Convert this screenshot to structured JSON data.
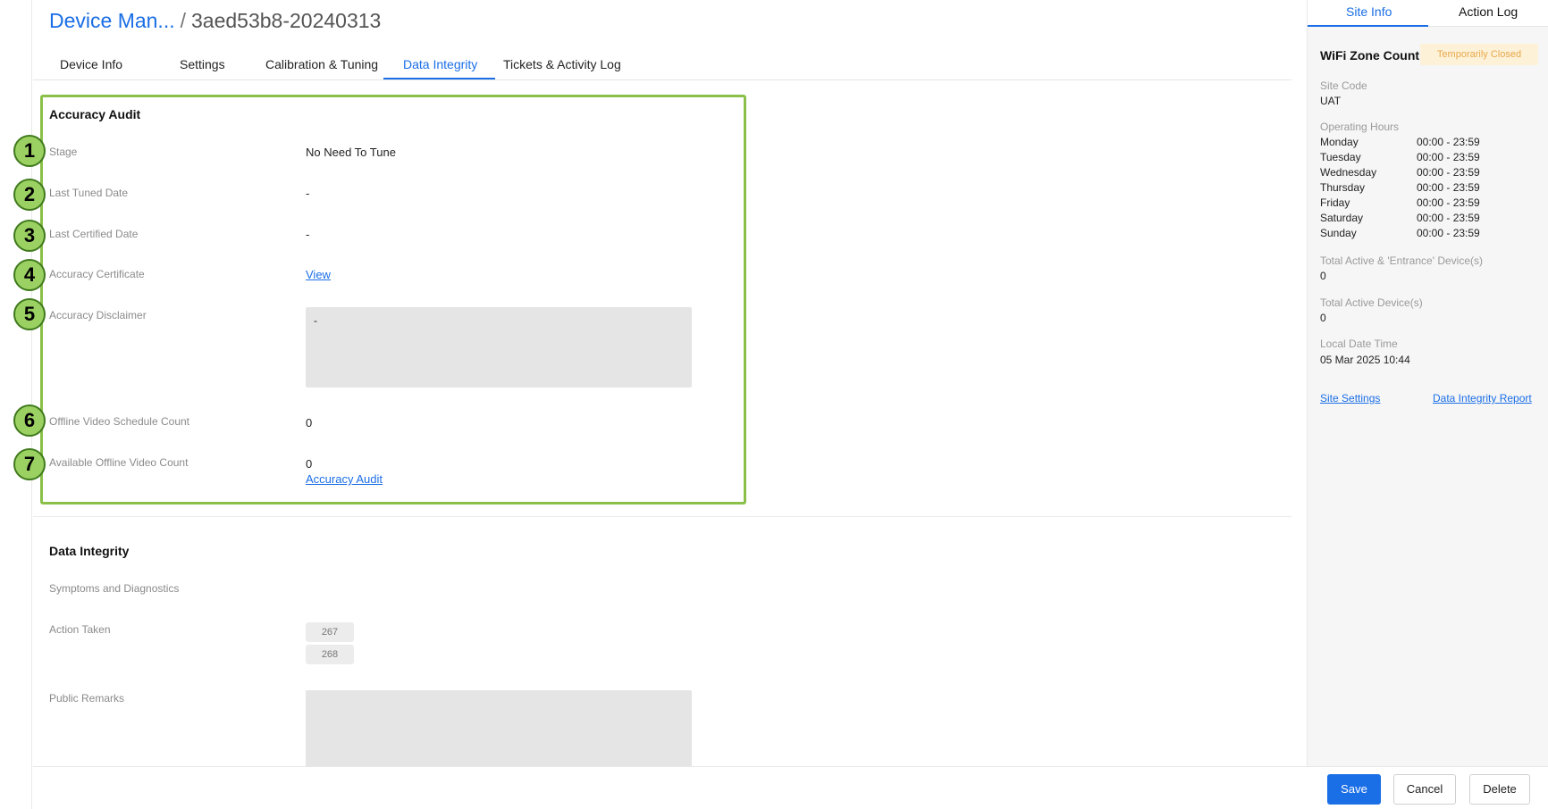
{
  "header": {
    "breadcrumb": "Device Man...",
    "separator": "/",
    "device_id": "3aed53b8-20240313"
  },
  "tabs": [
    {
      "label": "Device Info"
    },
    {
      "label": "Settings"
    },
    {
      "label": "Calibration & Tuning"
    },
    {
      "label": "Data Integrity",
      "active": true
    },
    {
      "label": "Tickets & Activity Log"
    }
  ],
  "accuracy_audit": {
    "title": "Accuracy Audit",
    "markers": [
      "1",
      "2",
      "3",
      "4",
      "5",
      "6",
      "7"
    ],
    "fields": {
      "stage": {
        "label": "Stage",
        "value": "No Need To Tune"
      },
      "last_tuned": {
        "label": "Last Tuned Date",
        "value": "-"
      },
      "last_certified": {
        "label": "Last Certified Date",
        "value": "-"
      },
      "certificate": {
        "label": "Accuracy Certificate",
        "value": "View"
      },
      "disclaimer": {
        "label": "Accuracy Disclaimer",
        "value": "-"
      },
      "offline_schedule": {
        "label": "Offline Video Schedule Count",
        "value": "0"
      },
      "offline_available": {
        "label": "Available Offline Video Count",
        "value": "0",
        "link": "Accuracy Audit"
      }
    },
    "highlight_color": "#8ac04a"
  },
  "data_integrity": {
    "title": "Data Integrity",
    "symptoms_label": "Symptoms and Diagnostics",
    "action_label": "Action Taken",
    "actions": [
      "267",
      "268"
    ],
    "remarks_label": "Public Remarks"
  },
  "right_panel": {
    "tabs": [
      "Site Info",
      "Action Log"
    ],
    "title": "WiFi Zone Count",
    "status": "Temporarily Closed",
    "site_code_label": "Site Code",
    "site_code": "UAT",
    "hours_label": "Operating Hours",
    "hours": [
      {
        "day": "Monday",
        "time": "00:00 - 23:59"
      },
      {
        "day": "Tuesday",
        "time": "00:00 - 23:59"
      },
      {
        "day": "Wednesday",
        "time": "00:00 - 23:59"
      },
      {
        "day": "Thursday",
        "time": "00:00 - 23:59"
      },
      {
        "day": "Friday",
        "time": "00:00 - 23:59"
      },
      {
        "day": "Saturday",
        "time": "00:00 - 23:59"
      },
      {
        "day": "Sunday",
        "time": "00:00 - 23:59"
      }
    ],
    "total_active_entrance_label": "Total Active & 'Entrance' Device(s)",
    "total_active_entrance": "0",
    "total_active_label": "Total Active Device(s)",
    "total_active": "0",
    "local_time_label": "Local Date Time",
    "local_time": "05 Mar 2025 10:44",
    "site_settings_link": "Site Settings",
    "report_link": "Data Integrity Report"
  },
  "footer": {
    "save": "Save",
    "cancel": "Cancel",
    "delete": "Delete"
  },
  "colors": {
    "accent": "#1a6ee6",
    "highlight": "#8ac04a",
    "status_bg": "#fdf1d8",
    "status_text": "#e8a84a"
  }
}
